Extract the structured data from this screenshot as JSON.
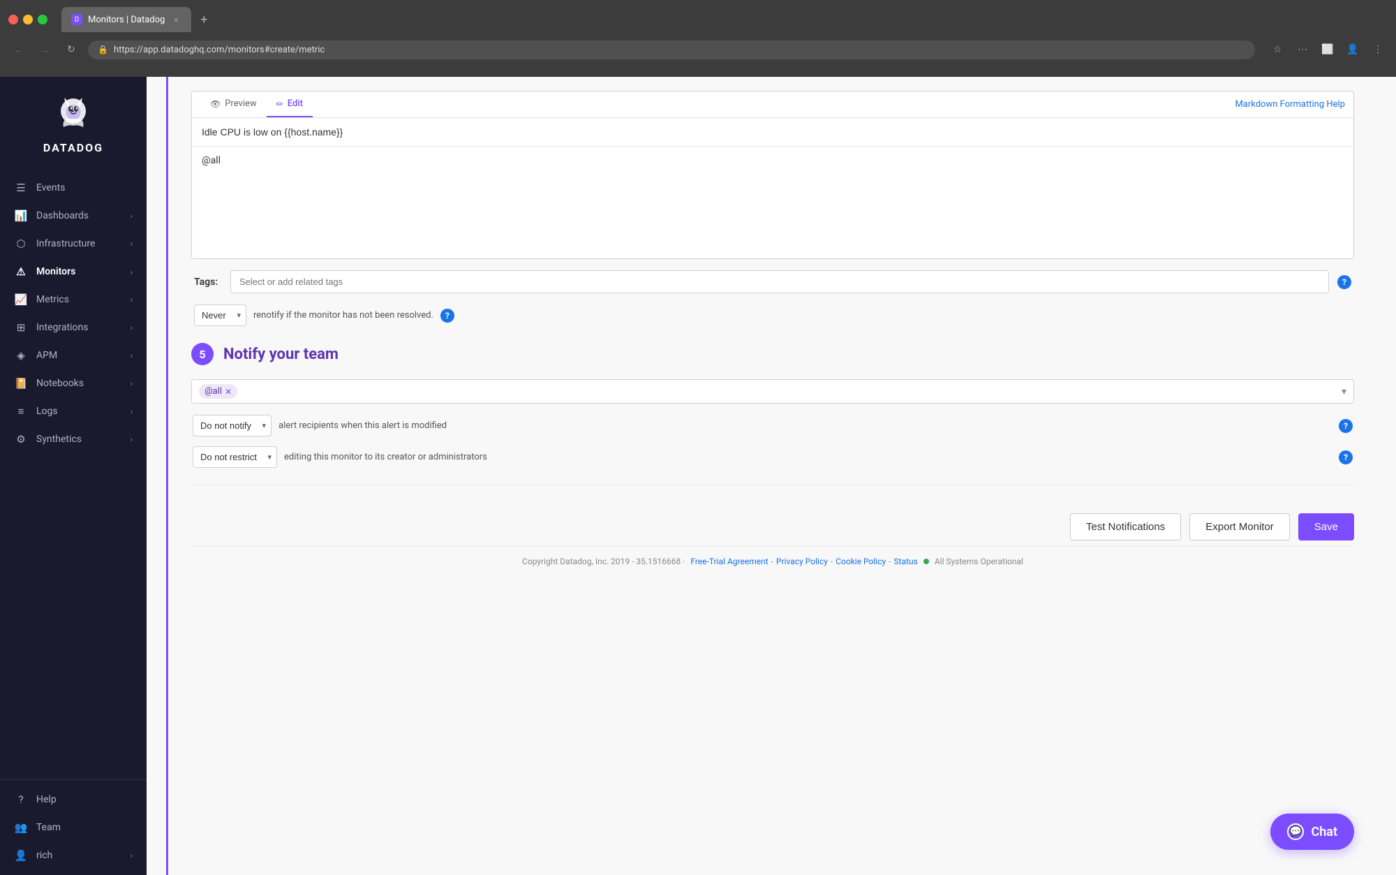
{
  "browser": {
    "tab_label": "Monitors | Datadog",
    "tab_close": "×",
    "new_tab": "+",
    "url": "https://app.datadoghq.com/monitors#create/metric",
    "nav_back": "←",
    "nav_forward": "→",
    "nav_refresh": "↻"
  },
  "sidebar": {
    "logo_text": "DATADOG",
    "items": [
      {
        "id": "events",
        "label": "Events",
        "icon": "☰",
        "has_chevron": false
      },
      {
        "id": "dashboards",
        "label": "Dashboards",
        "icon": "📊",
        "has_chevron": true
      },
      {
        "id": "infrastructure",
        "label": "Infrastructure",
        "icon": "🔧",
        "has_chevron": true
      },
      {
        "id": "monitors",
        "label": "Monitors",
        "icon": "⚠",
        "has_chevron": true,
        "active": true
      },
      {
        "id": "metrics",
        "label": "Metrics",
        "icon": "📈",
        "has_chevron": true
      },
      {
        "id": "integrations",
        "label": "Integrations",
        "icon": "🔌",
        "has_chevron": true
      },
      {
        "id": "apm",
        "label": "APM",
        "icon": "⟨⟩",
        "has_chevron": true
      },
      {
        "id": "notebooks",
        "label": "Notebooks",
        "icon": "📓",
        "has_chevron": true
      },
      {
        "id": "logs",
        "label": "Logs",
        "icon": "≡",
        "has_chevron": true
      },
      {
        "id": "synthetics",
        "label": "Synthetics",
        "icon": "⚙",
        "has_chevron": true
      }
    ],
    "bottom_items": [
      {
        "id": "help",
        "label": "Help",
        "icon": "?"
      },
      {
        "id": "team",
        "label": "Team",
        "icon": "👤"
      },
      {
        "id": "user",
        "label": "rich",
        "icon": "👤"
      }
    ]
  },
  "editor": {
    "tab_preview": "Preview",
    "tab_edit": "Edit",
    "preview_icon": "👁",
    "edit_icon": "✏",
    "markdown_help": "Markdown Formatting Help",
    "title_value": "Idle CPU is low on {{host.name}}",
    "body_value": "@all"
  },
  "tags": {
    "label": "Tags:",
    "placeholder": "Select or add related tags"
  },
  "renotify": {
    "option": "Never",
    "text": "renotify if the monitor has not been resolved."
  },
  "step5": {
    "badge": "5",
    "title": "Notify your team",
    "tag_chip": "@all",
    "do_not_notify_option": "Do not notify",
    "do_not_notify_text": "alert recipients when this alert is modified",
    "do_not_restrict_option": "Do not restrict",
    "do_not_restrict_text": "editing this monitor to its creator or administrators"
  },
  "actions": {
    "test_notifications": "Test Notifications",
    "export_monitor": "Export Monitor",
    "save": "Save"
  },
  "footer": {
    "copyright": "Copyright Datadog, Inc. 2019 - 35.1516668 ·",
    "free_trial": "Free-Trial Agreement",
    "privacy": "Privacy Policy",
    "cookie": "Cookie Policy",
    "status": "Status",
    "systems_operational": "All Systems Operational"
  },
  "chat": {
    "label": "Chat"
  }
}
